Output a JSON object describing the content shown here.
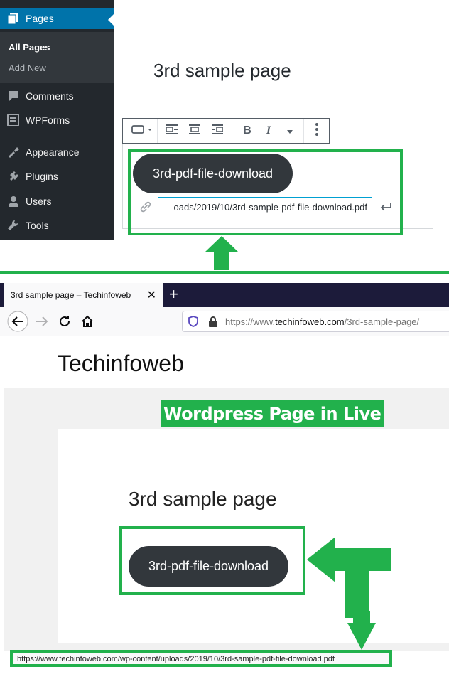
{
  "editor": {
    "sidebar": {
      "items": [
        {
          "label": "Pages",
          "icon": "pages-icon"
        },
        {
          "label": "Comments",
          "icon": "comments-icon"
        },
        {
          "label": "WPForms",
          "icon": "wpforms-icon"
        },
        {
          "label": "Appearance",
          "icon": "appearance-icon"
        },
        {
          "label": "Plugins",
          "icon": "plugins-icon"
        },
        {
          "label": "Users",
          "icon": "users-icon"
        },
        {
          "label": "Tools",
          "icon": "tools-icon"
        }
      ],
      "submenu": [
        {
          "label": "All Pages"
        },
        {
          "label": "Add New"
        }
      ]
    },
    "page_title": "3rd sample page",
    "button_text": "3rd-pdf-file-download",
    "link_url": "oads/2019/10/3rd-sample-pdf-file-download.pdf"
  },
  "browser": {
    "tab_title": "3rd sample page – Techinfoweb",
    "url_prefix": "https://www.",
    "url_domain": "techinfoweb.com",
    "url_path": "/3rd-sample-page/",
    "site_title": "Techinfoweb",
    "annotation": "Wordpress Page in Live",
    "page_title": "3rd sample page",
    "button_text": "3rd-pdf-file-download",
    "status_url": "https://www.techinfoweb.com/wp-content/uploads/2019/10/3rd-sample-pdf-file-download.pdf"
  },
  "colors": {
    "highlight_green": "#22b14c",
    "admin_sidebar": "#23282d",
    "admin_active": "#0073aa",
    "button_dark": "#32373c"
  }
}
